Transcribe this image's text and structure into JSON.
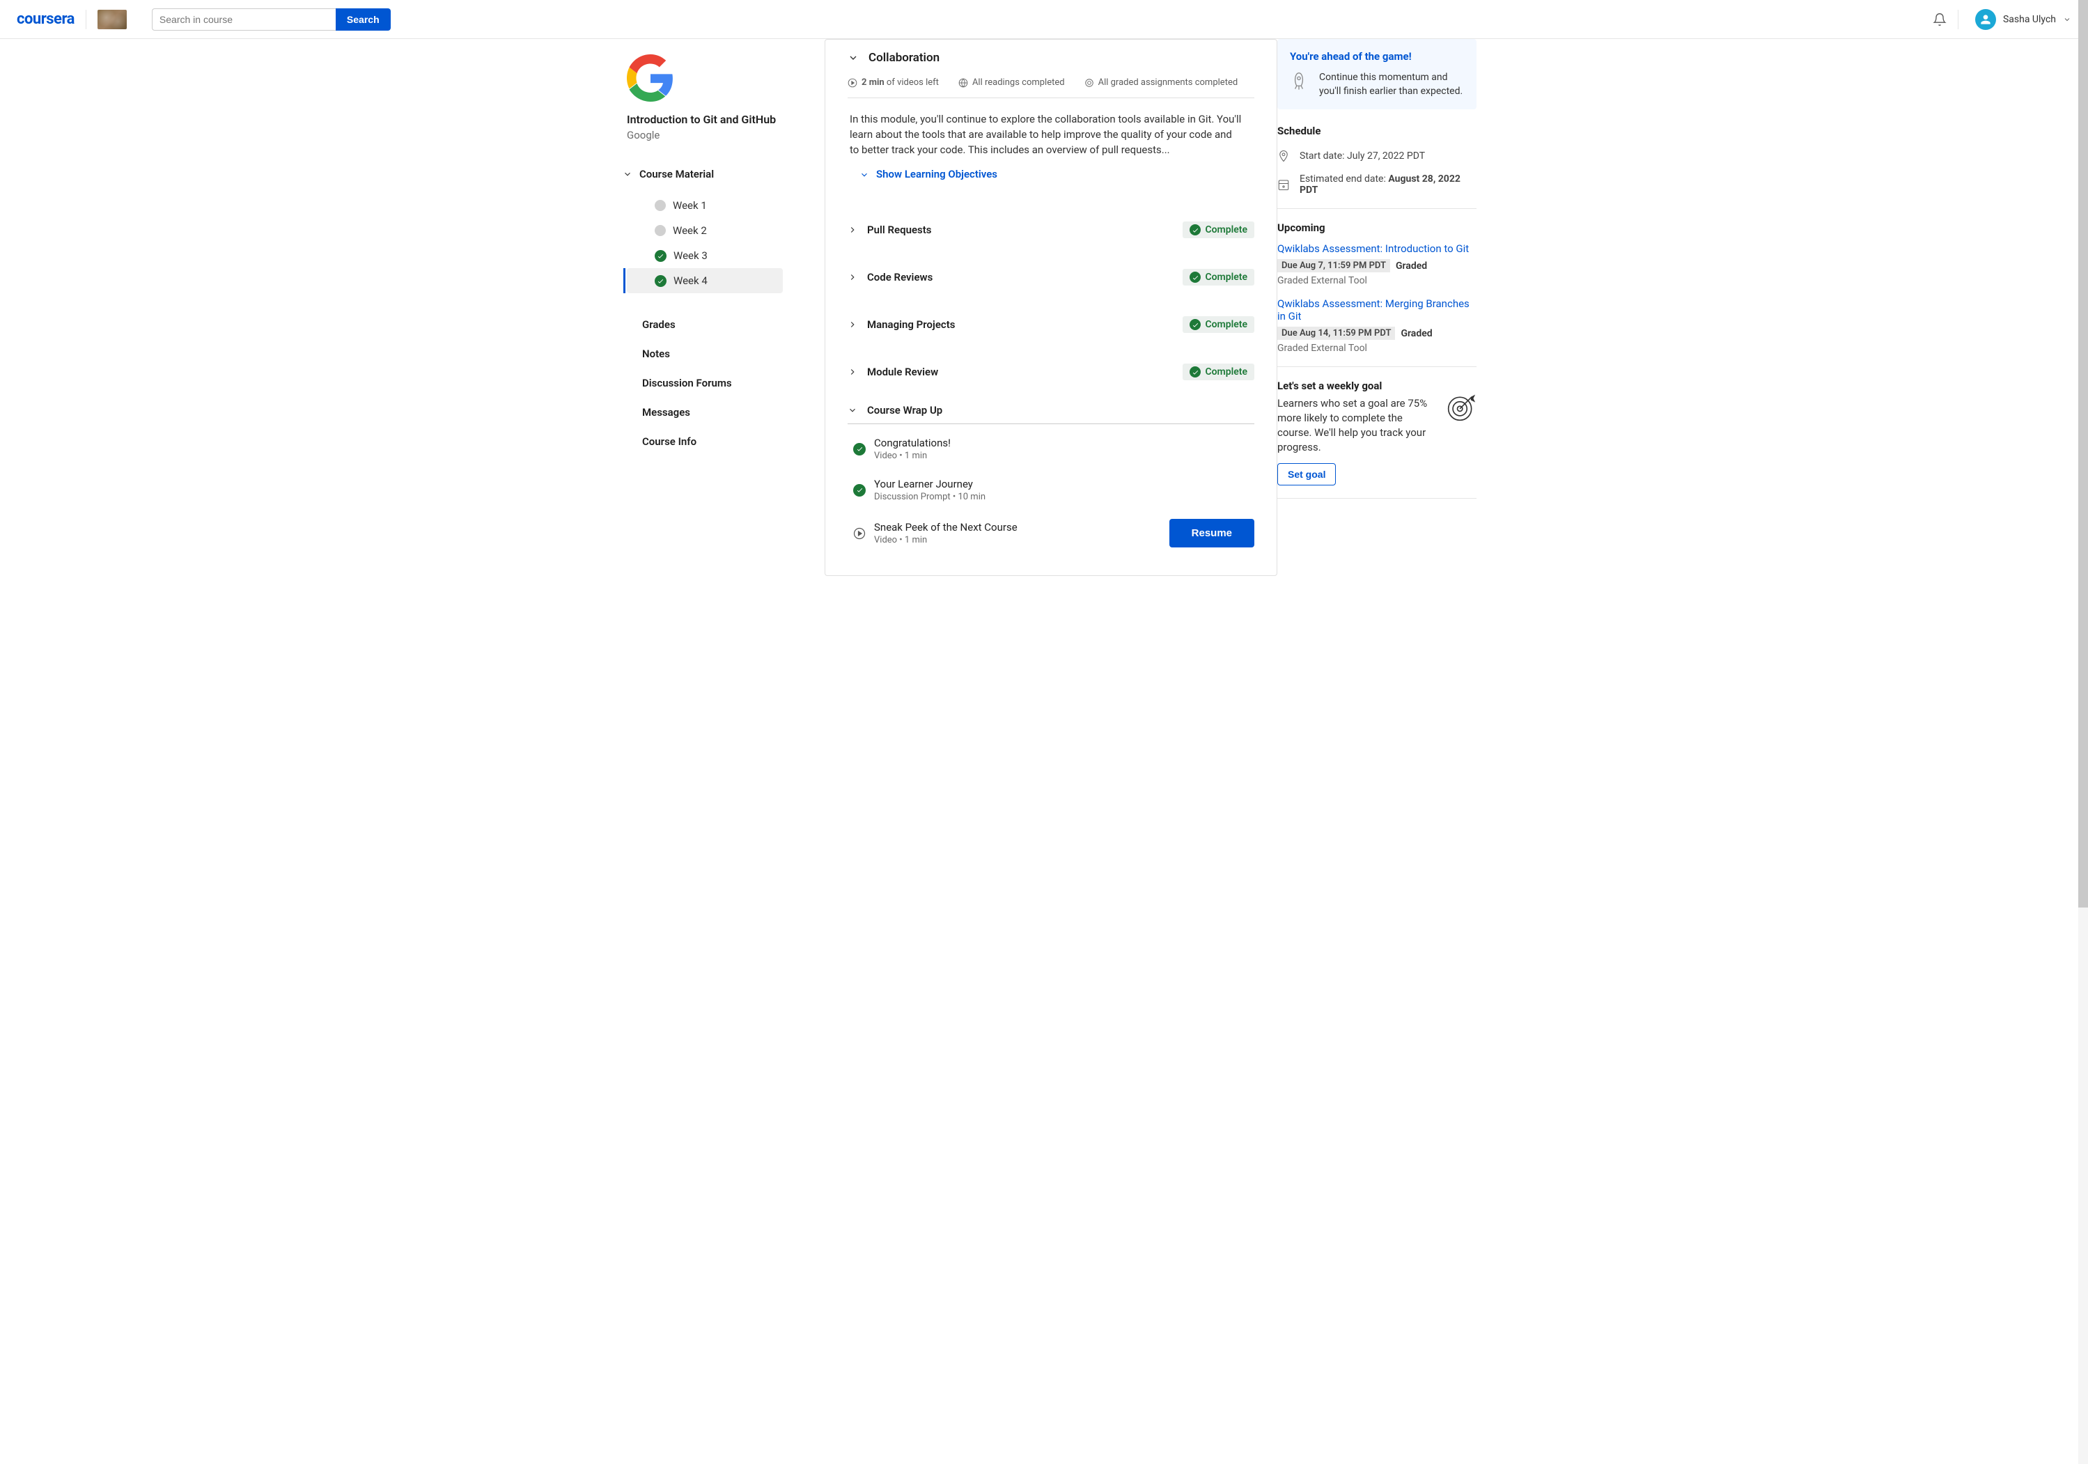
{
  "header": {
    "logo_text": "coursera",
    "search_placeholder": "Search in course",
    "search_button": "Search",
    "user_name": "Sasha Ulych"
  },
  "sidebar": {
    "course_title": "Introduction to Git and GitHub",
    "provider": "Google",
    "section_label": "Course Material",
    "weeks": [
      {
        "label": "Week 1",
        "status": "none"
      },
      {
        "label": "Week 2",
        "status": "none"
      },
      {
        "label": "Week 3",
        "status": "complete"
      },
      {
        "label": "Week 4",
        "status": "complete",
        "active": true
      }
    ],
    "nav": {
      "grades": "Grades",
      "notes": "Notes",
      "forums": "Discussion Forums",
      "messages": "Messages",
      "courseinfo": "Course Info"
    }
  },
  "module": {
    "title": "Collaboration",
    "stats": {
      "video_bold": "2 min",
      "video_rest": "of videos left",
      "readings": "All readings completed",
      "assignments": "All graded assignments completed"
    },
    "description": "In this module, you'll continue to explore the collaboration tools available in Git. You'll learn about the tools that are available to help improve the quality of your code and to better track your code. This includes an overview of pull requests...",
    "show_objectives": "Show Learning Objectives",
    "sections": [
      {
        "title": "Pull Requests",
        "badge": "Complete"
      },
      {
        "title": "Code Reviews",
        "badge": "Complete"
      },
      {
        "title": "Managing Projects",
        "badge": "Complete"
      },
      {
        "title": "Module Review",
        "badge": "Complete"
      }
    ],
    "wrapup_title": "Course Wrap Up",
    "lessons": [
      {
        "title": "Congratulations!",
        "meta": "Video • 1 min",
        "status": "complete"
      },
      {
        "title": "Your Learner Journey",
        "meta": "Discussion Prompt • 10 min",
        "status": "complete"
      },
      {
        "title": "Sneak Peek of the Next Course",
        "meta": "Video • 1 min",
        "status": "play"
      }
    ],
    "resume_button": "Resume"
  },
  "right": {
    "ahead_title": "You're ahead of the game!",
    "ahead_text": "Continue this momentum and you'll finish earlier than expected.",
    "schedule_title": "Schedule",
    "start_date_label": "Start date: July 27, 2022 PDT",
    "end_date_label": "Estimated end date: ",
    "end_date_bold": "August 28, 2022 PDT",
    "upcoming_title": "Upcoming",
    "upcoming": [
      {
        "link": "Qwiklabs Assessment: Introduction to Git",
        "due": "Due Aug 7, 11:59 PM PDT",
        "graded": "Graded",
        "tool": "Graded External Tool"
      },
      {
        "link": "Qwiklabs Assessment: Merging Branches in Git",
        "due": "Due Aug 14, 11:59 PM PDT",
        "graded": "Graded",
        "tool": "Graded External Tool"
      }
    ],
    "goal_title": "Let's set a weekly goal",
    "goal_text": "Learners who set a goal are 75% more likely to complete the course. We'll help you track your progress.",
    "goal_button": "Set goal"
  }
}
